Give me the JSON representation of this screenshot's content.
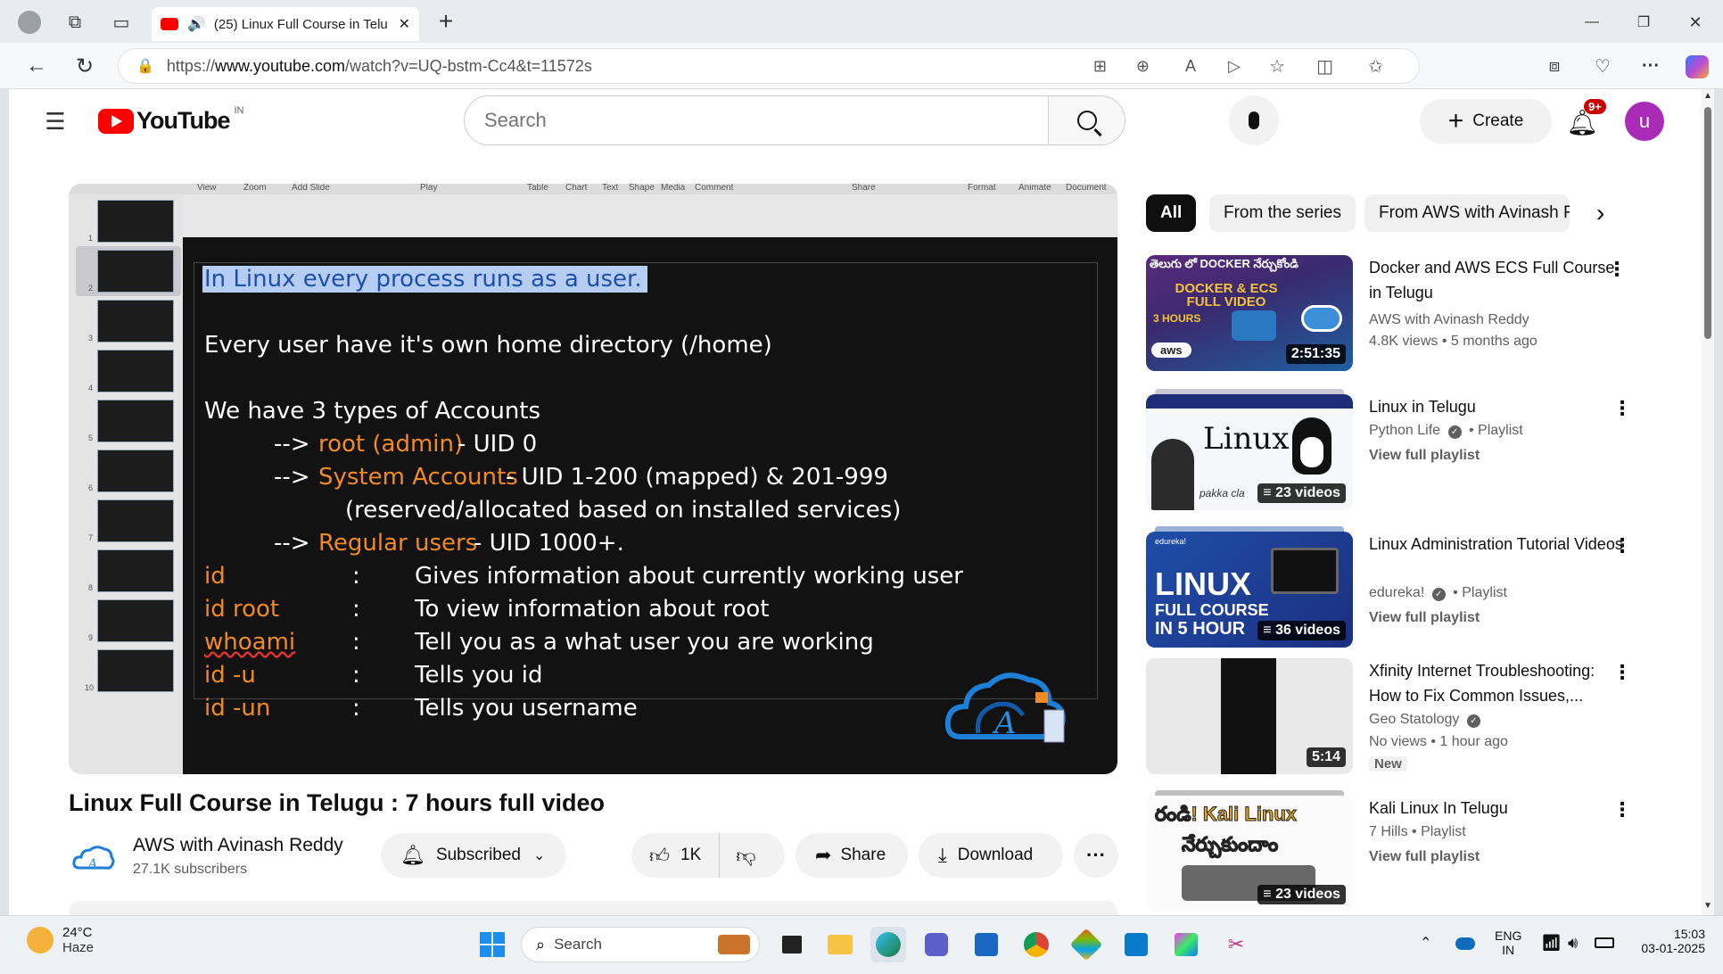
{
  "browser": {
    "tab_title": "(25) Linux Full Course in Telu",
    "tab_close": "✕",
    "new_tab": "+",
    "url_prefix": "https://",
    "url_host": "www.youtube.com",
    "url_path": "/watch?v=UQ-bstm-Cc4&t=11572s",
    "window_min": "—",
    "window_max": "❐",
    "window_close": "✕"
  },
  "youtube": {
    "logo_text": "YouTube",
    "region": "IN",
    "search_placeholder": "Search",
    "create_label": "Create",
    "notif_count": "9+",
    "avatar_letter": "u",
    "brand_color": "#ff0000",
    "avatar_color": "#a82ab5"
  },
  "slide": {
    "menu": [
      "View",
      "Zoom",
      "Add Slide",
      "Play",
      "Table",
      "Chart",
      "Text",
      "Shape",
      "Media",
      "Comment",
      "Share",
      "Format",
      "Animate",
      "Document"
    ],
    "thumb_numbers": [
      "1",
      "2",
      "3",
      "4",
      "5",
      "6",
      "7",
      "8",
      "9",
      "10"
    ],
    "highlight": "In Linux every process runs as a user.",
    "line1": "Every user have it's own home directory (/home)",
    "line2": "We have 3 types of Accounts",
    "arrow": "-->",
    "acc1_name": "root (admin)",
    "acc1_rest": " - UID 0",
    "acc2_name": "System Accounts",
    "acc2_rest": " - UID 1-200 (mapped) & 201-999",
    "acc2_cont": "(reserved/allocated based on installed services)",
    "acc3_name": "Regular users",
    "acc3_rest": "  - UID 1000+.",
    "commands": [
      {
        "cmd": "id",
        "desc": "Gives  information about currently working user"
      },
      {
        "cmd": "id root",
        "desc": "To view information about root"
      },
      {
        "cmd": "whoami",
        "desc": "Tell you as a what user you are working"
      },
      {
        "cmd": "id -u",
        "desc": "Tells you id"
      },
      {
        "cmd": "id -un",
        "desc": "Tells you username"
      }
    ],
    "colon": ":"
  },
  "video": {
    "title": "Linux Full Course in Telugu : 7 hours full video",
    "channel": "AWS with Avinash Reddy",
    "subscribers": "27.1K subscribers",
    "subscribed_label": "Subscribed",
    "likes": "1K",
    "share_label": "Share",
    "download_label": "Download"
  },
  "chips": [
    "All",
    "From the series",
    "From AWS with Avinash R"
  ],
  "recommendations": [
    {
      "title": "Docker and AWS ECS Full Course in Telugu",
      "channel": "AWS with Avinash Reddy",
      "meta": "4.8K views  • 5 months ago",
      "badge": "2:51:35",
      "thumb_text": "తెలుగు లో DOCKER నేర్చుకోండి",
      "thumb_sub": "DOCKER & ECS FULL VIDEO",
      "thumb_hours": "3 HOURS",
      "thumb_aws": "aws"
    },
    {
      "title": "Linux in Telugu",
      "channel": "Python Life",
      "meta": "• Playlist",
      "link": "View full playlist",
      "badge": "23 videos",
      "thumb_text": "Linux",
      "thumb_sub": "pakka cla"
    },
    {
      "title": "Linux Administration Tutorial Videos",
      "channel": "edureka!",
      "meta": "• Playlist",
      "link": "View full playlist",
      "badge": "36 videos",
      "thumb_brand": "edureka!",
      "thumb_text": "LINUX",
      "thumb_sub": "FULL COURSE",
      "thumb_sub2": "IN 5 HOUR"
    },
    {
      "title": "Xfinity Internet Troubleshooting: How to Fix Common Issues,...",
      "channel": "Geo Statology",
      "meta": "No views  • 1 hour ago",
      "new": "New",
      "badge": "5:14"
    },
    {
      "title": "Kali Linux In Telugu",
      "channel": "7 Hills",
      "meta": "• Playlist",
      "link": "View full playlist",
      "badge": "23 videos",
      "thumb_text": "రండి! Kali Linux",
      "thumb_sub": "నేర్చుకుందాం"
    }
  ],
  "taskbar": {
    "temp": "24°C",
    "weather": "Haze",
    "search": "Search",
    "lang1": "ENG",
    "lang2": "IN",
    "time": "15:03",
    "date": "03-01-2025"
  }
}
